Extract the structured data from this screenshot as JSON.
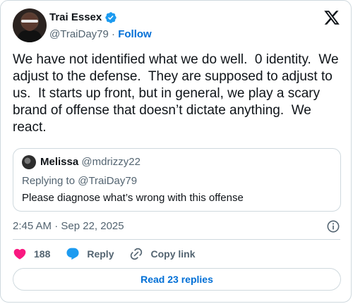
{
  "author": {
    "name": "Trai Essex",
    "handle": "@TraiDay79",
    "separator": " · ",
    "follow_label": "Follow"
  },
  "tweet": {
    "text": "We have not identified what we do well.  0 identity.  We adjust to the defense.  They are supposed to adjust to us.  It starts up front, but in general, we play a scary brand of offense that doesn’t dictate anything.  We react.",
    "timestamp": "2:45 AM · Sep 22, 2025"
  },
  "quote": {
    "name": "Melissa",
    "handle": "@mdrizzy22",
    "replying_to": "Replying to @TraiDay79",
    "text": "Please diagnose what’s wrong with this offense"
  },
  "actions": {
    "like_count": "188",
    "reply_label": "Reply",
    "copy_link_label": "Copy link"
  },
  "read_replies_label": "Read 23 replies",
  "colors": {
    "like": "#f91880",
    "reply": "#1d9bf0",
    "link": "#006fd6",
    "verified": "#1d9bf0",
    "border": "#cfd9de",
    "secondary_text": "#536471"
  },
  "icons": {
    "brand": "x-logo-icon",
    "verified": "verified-badge-icon",
    "info": "info-icon",
    "like": "heart-icon",
    "reply": "speech-bubble-icon",
    "copy_link": "link-icon"
  }
}
